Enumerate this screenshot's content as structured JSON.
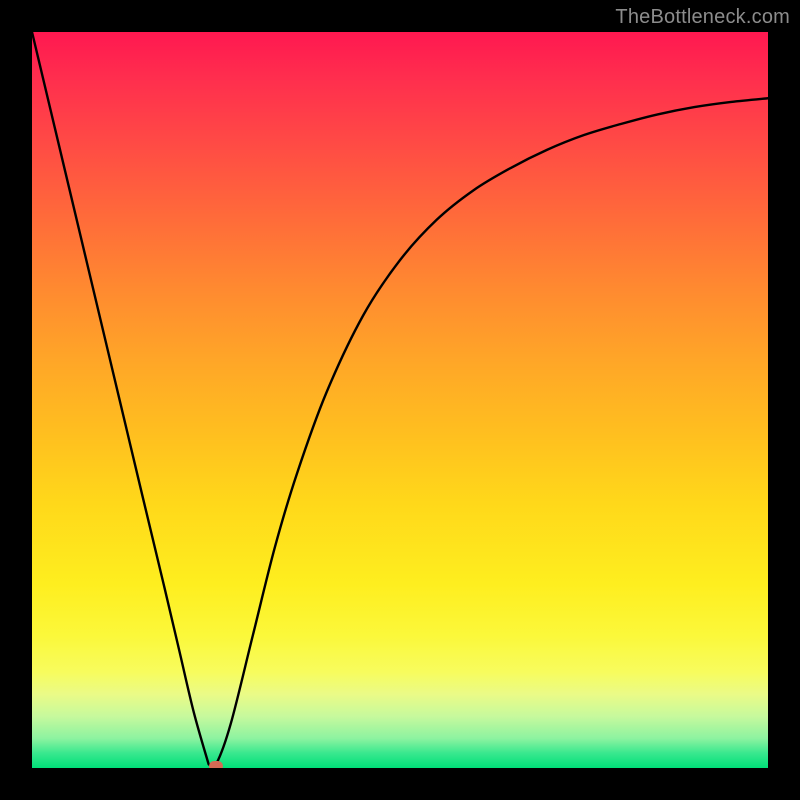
{
  "watermark": "TheBottleneck.com",
  "chart_data": {
    "type": "line",
    "title": "",
    "xlabel": "",
    "ylabel": "",
    "xlim": [
      0,
      100
    ],
    "ylim": [
      0,
      100
    ],
    "grid": false,
    "series": [
      {
        "name": "bottleneck-curve",
        "x": [
          0,
          5,
          10,
          15,
          18,
          20,
          22,
          24,
          25,
          27,
          30,
          33,
          36,
          40,
          45,
          50,
          55,
          60,
          65,
          70,
          75,
          80,
          85,
          90,
          95,
          100
        ],
        "values": [
          100,
          79,
          58,
          37,
          24.5,
          16,
          7.5,
          0.5,
          0.5,
          6,
          18,
          30,
          40,
          51,
          61.5,
          69,
          74.5,
          78.5,
          81.5,
          84,
          86,
          87.5,
          88.8,
          89.8,
          90.5,
          91
        ]
      }
    ],
    "marker": {
      "x": 25,
      "y": 0.3
    },
    "background_gradient": {
      "top": "#ff1850",
      "mid": "#ffd81a",
      "bottom": "#00df78"
    }
  }
}
